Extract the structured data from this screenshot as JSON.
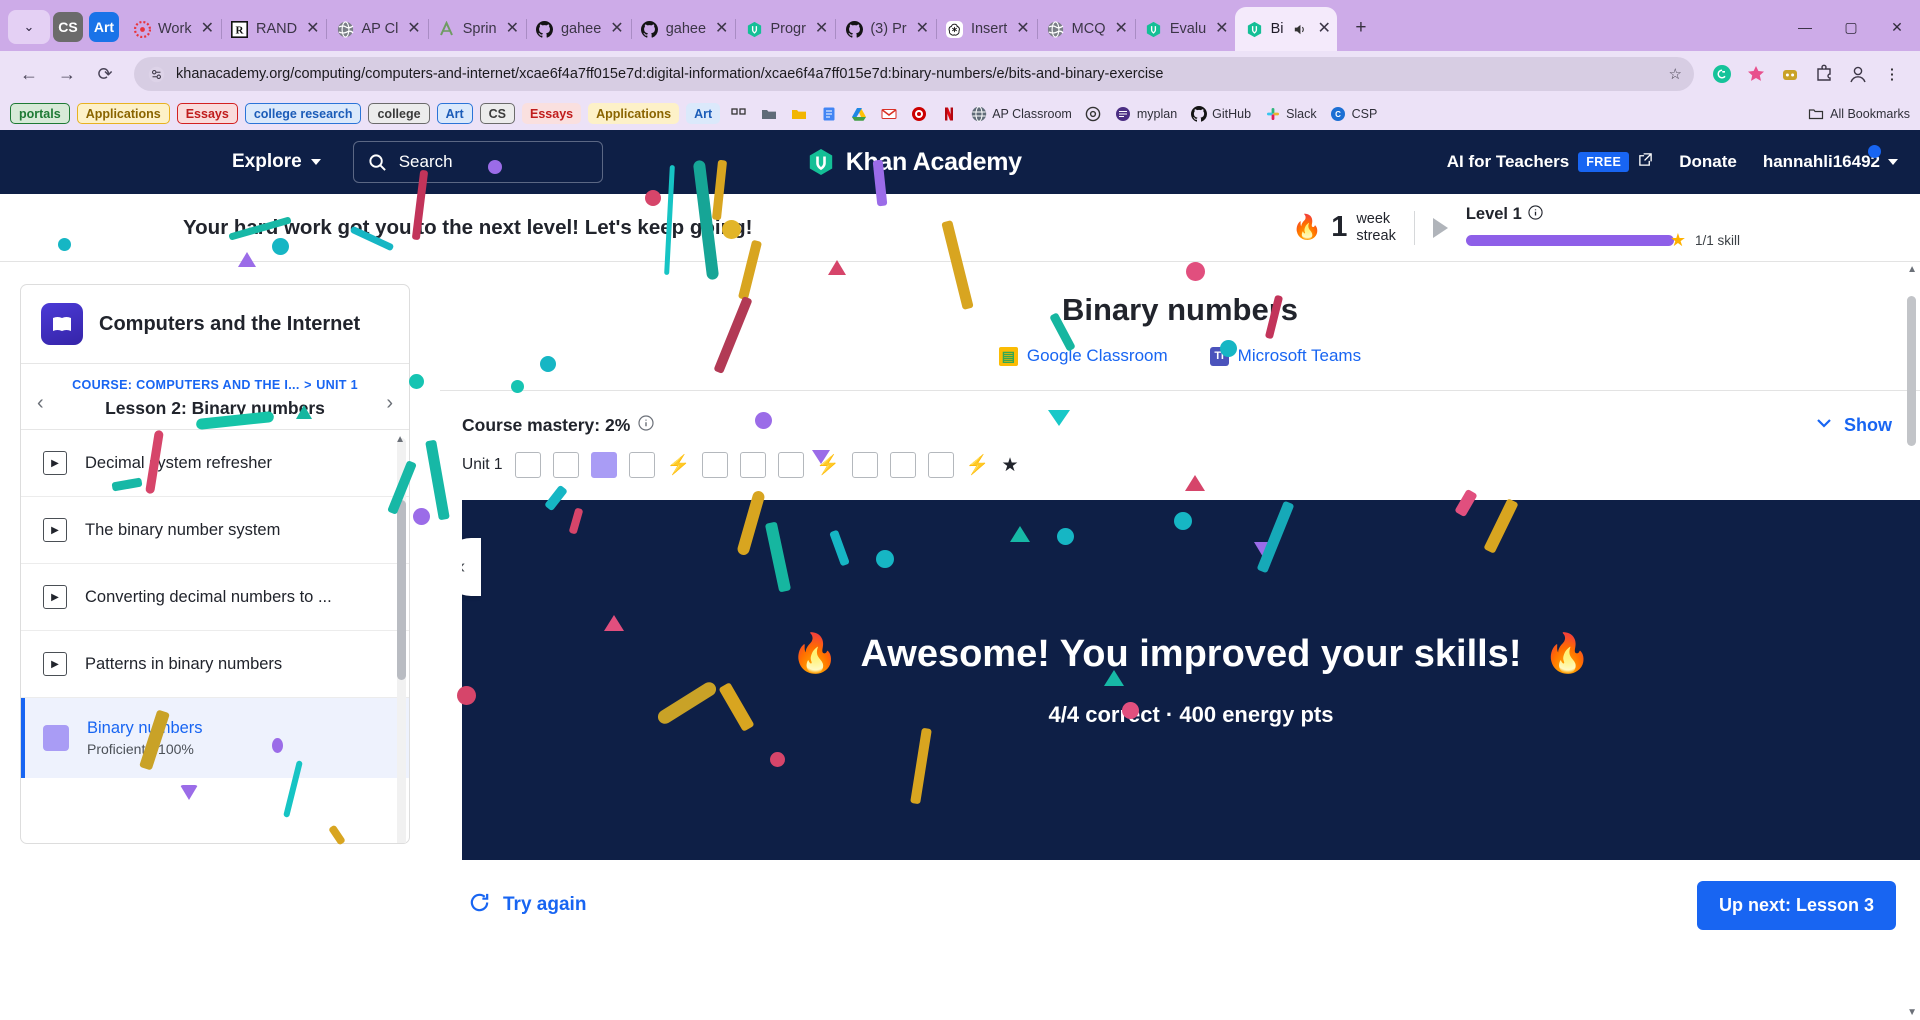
{
  "browser": {
    "tabs": [
      {
        "title": "Work",
        "icon": "canvas-icon"
      },
      {
        "title": "RAND",
        "icon": "r-icon"
      },
      {
        "title": "AP Cl",
        "icon": "globe-icon"
      },
      {
        "title": "Sprin",
        "icon": "sprint-icon"
      },
      {
        "title": "gahee",
        "icon": "github-icon"
      },
      {
        "title": "gahee",
        "icon": "github-icon"
      },
      {
        "title": "Progr",
        "icon": "khan-icon"
      },
      {
        "title": "(3) Pr",
        "icon": "github-icon"
      },
      {
        "title": "Insert",
        "icon": "openai-icon"
      },
      {
        "title": "MCQ",
        "icon": "globe-icon"
      },
      {
        "title": "Evalu",
        "icon": "khan-icon"
      }
    ],
    "active_tab": {
      "title": "Bi",
      "icon": "khan-icon",
      "audio": "speaker-icon"
    },
    "pinned": [
      {
        "label": "CS"
      },
      {
        "label": "Art"
      }
    ],
    "url": "khanacademy.org/computing/computers-and-internet/xcae6f4a7ff015e7d:digital-information/xcae6f4a7ff015e7d:binary-numbers/e/bits-and-binary-exercise",
    "new_tab_label": "+",
    "window_controls": {
      "minimize": "—",
      "maximize": "▢",
      "close": "✕"
    },
    "bookmarks": [
      {
        "label": "portals",
        "style": "green"
      },
      {
        "label": "Applications",
        "style": "yellow"
      },
      {
        "label": "Essays",
        "style": "red"
      },
      {
        "label": "college research",
        "style": "blue"
      },
      {
        "label": "college",
        "style": "gray"
      },
      {
        "label": "Art",
        "style": "blue"
      },
      {
        "label": "CS",
        "style": "gray"
      },
      {
        "label": "Essays",
        "style": "softred"
      },
      {
        "label": "Applications",
        "style": "softyellow"
      },
      {
        "label": "Art",
        "style": "softblue"
      }
    ],
    "bookmark_icons": [
      "apps-icon",
      "folder-dark-icon",
      "folder-yellow-icon",
      "doc-blue-icon",
      "drive-icon",
      "gmail-icon",
      "target-icon",
      "netflix-icon"
    ],
    "bookmark_named": [
      {
        "label": "AP Classroom",
        "icon": "globe-icon"
      },
      {
        "label": "",
        "icon": "circle-icon"
      },
      {
        "label": "myplan",
        "icon": "myplan-icon"
      },
      {
        "label": "GitHub",
        "icon": "github-icon"
      },
      {
        "label": "Slack",
        "icon": "slack-icon"
      },
      {
        "label": "CSP",
        "icon": "csp-icon"
      }
    ],
    "all_bookmarks_label": "All Bookmarks"
  },
  "ka_header": {
    "explore": "Explore",
    "search_placeholder": "Search",
    "logo_text": "Khan Academy",
    "ai_for_teachers": "AI for Teachers",
    "free_badge": "FREE",
    "donate": "Donate",
    "username": "hannahli16492"
  },
  "banner": {
    "message": "Your hard work got you to the next level! Let's keep going!",
    "streak_number": "1",
    "streak_label_line1": "week",
    "streak_label_line2": "streak",
    "level_title": "Level 1",
    "level_skill_count": "1",
    "level_skill_total": "/1 skill"
  },
  "sidebar": {
    "course_title": "Computers and the Internet",
    "breadcrumb_course": "COURSE: COMPUTERS AND THE I...",
    "breadcrumb_sep": ">",
    "breadcrumb_unit": "UNIT 1",
    "lesson_title": "Lesson 2: Binary numbers",
    "items": [
      {
        "label": "Decimal system refresher",
        "type": "video"
      },
      {
        "label": "The binary number system",
        "type": "video"
      },
      {
        "label": "Converting decimal numbers to ...",
        "type": "video"
      },
      {
        "label": "Patterns in binary numbers",
        "type": "video"
      }
    ],
    "current_item": {
      "label": "Binary numbers",
      "status": "Proficient • 100%"
    }
  },
  "main": {
    "exercise_title": "Binary numbers",
    "google_classroom": "Google Classroom",
    "microsoft_teams": "Microsoft Teams",
    "course_mastery": "Course mastery: 2%",
    "show_label": "Show",
    "unit_label": "Unit 1",
    "pips": [
      "empty",
      "empty",
      "filled",
      "empty",
      "bolt",
      "empty",
      "empty",
      "empty",
      "bolt",
      "empty",
      "empty",
      "empty",
      "bolt",
      "star"
    ],
    "celebration_title": "Awesome! You improved your skills!",
    "celebration_emoji_left": "🔥",
    "celebration_emoji_right": "🔥",
    "celebration_sub": "4/4 correct · 400 energy pts",
    "try_again": "Try again",
    "up_next": "Up next: Lesson 3"
  },
  "colors": {
    "ka_navy": "#0e1f46",
    "ka_blue": "#1865f2",
    "purple_progress": "#8e5fe8",
    "pip_filled": "#a99cf5",
    "chrome_purple": "#cdabe8"
  }
}
